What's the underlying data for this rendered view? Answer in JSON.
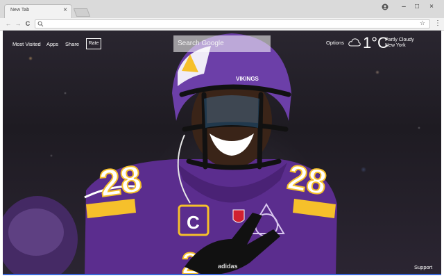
{
  "browser": {
    "tab_title": "New Tab",
    "tab_close": "×",
    "window_buttons": [
      "–",
      "□",
      "×"
    ],
    "nav": {
      "back": "←",
      "forward": "→",
      "reload": "C"
    },
    "omnibox_value": "",
    "star": "☆",
    "menu": "⋮"
  },
  "page": {
    "links": [
      "Most Visited",
      "Apps",
      "Share"
    ],
    "rate_label": "Rate",
    "search_placeholder": "Search Google",
    "options_label": "Options",
    "weather": {
      "temperature": "1°C",
      "condition": "Partly Cloudy",
      "city": "New York"
    },
    "support_label": "Support",
    "jersey_number": "28",
    "captain_patch": "C",
    "helmet_text": "VIKINGS"
  },
  "colors": {
    "vikings_purple": "#5b2d8e",
    "vikings_gold": "#f6c02b",
    "background_dark": "#1f1c23",
    "accent_blue": "#3a68d8"
  }
}
